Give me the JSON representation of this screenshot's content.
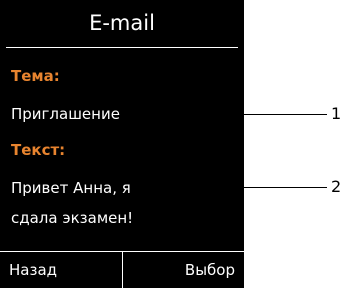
{
  "screen": {
    "title": "E-mail",
    "subject_label": "Тема:",
    "subject_value": "Приглашение",
    "text_label": "Текст:",
    "text_line_1": "Привет Анна, я",
    "text_line_2": "сдала экзамен!"
  },
  "softkeys": {
    "left": "Назад",
    "right": "Выбор"
  },
  "callouts": [
    "1",
    "2"
  ],
  "colors": {
    "screen_background": "#000000",
    "label_accent": "#e8842f",
    "text": "#ffffff"
  }
}
